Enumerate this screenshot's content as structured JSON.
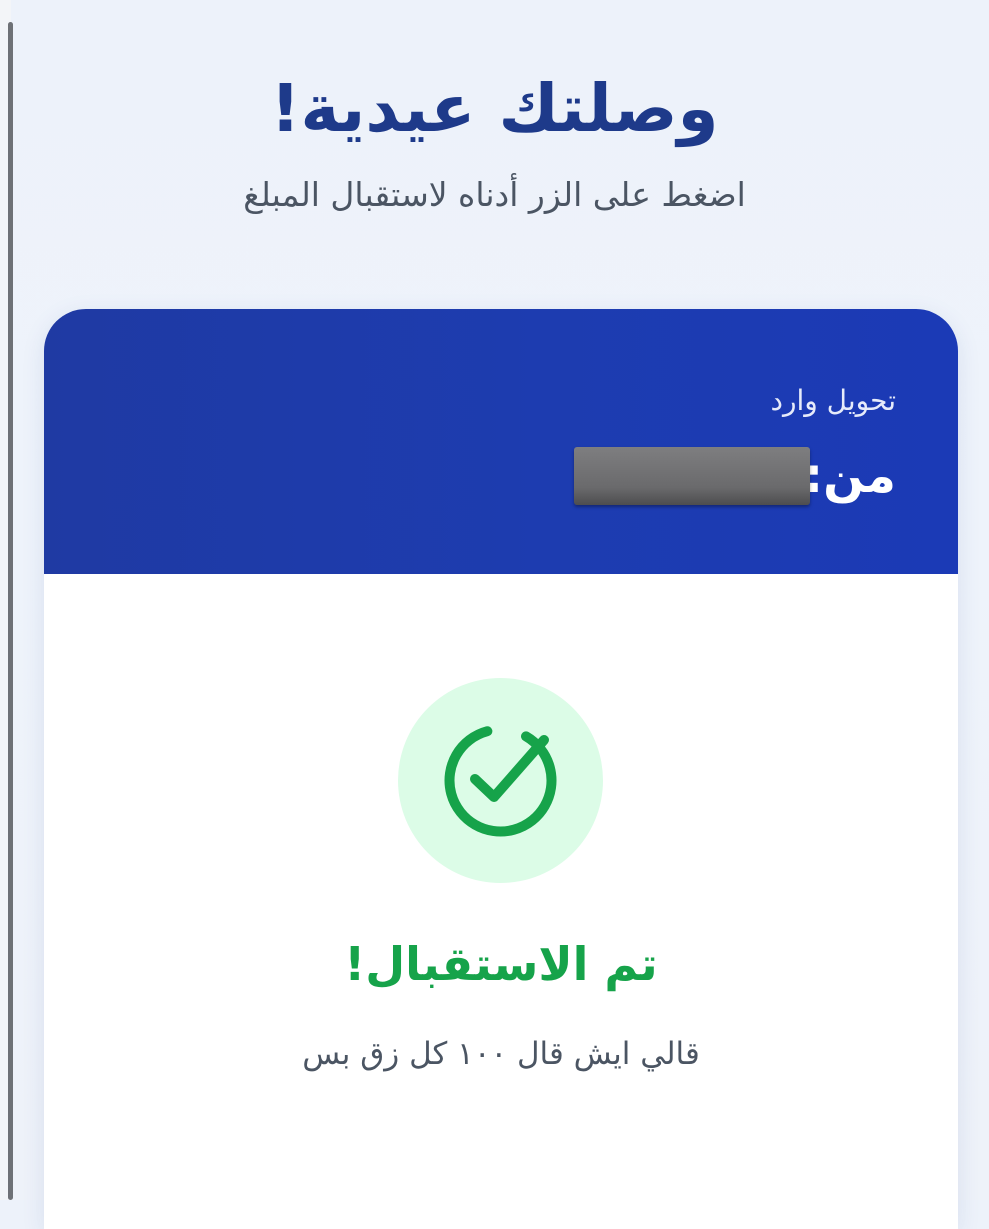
{
  "hero": {
    "title": "وصلتك عيدية!",
    "subtitle": "اضغط على الزر أدناه لاستقبال المبلغ"
  },
  "transfer_card": {
    "incoming_label": "تحويل وارد",
    "sender_label": "من:",
    "sender_name_redacted": true
  },
  "status": {
    "icon": "check-circle-icon",
    "title": "تم الاستقبال!",
    "message": "قالي ايش قال ١٠٠ كل زق بس"
  },
  "colors": {
    "brand_blue": "#1d3cb0",
    "title_blue": "#1e3a8a",
    "success_green": "#16a34a",
    "success_bg": "#dcfce7"
  }
}
